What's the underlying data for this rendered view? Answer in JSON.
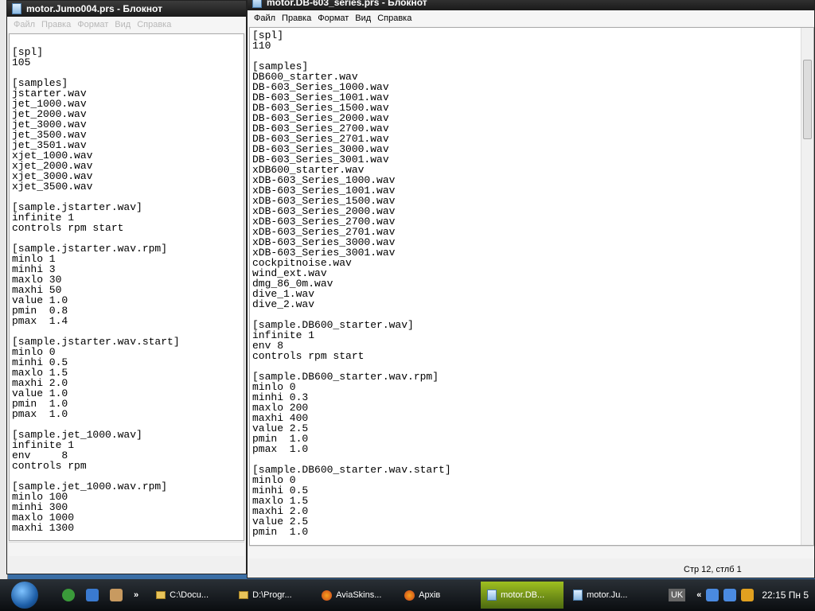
{
  "left_window": {
    "title": "motor.Jumo004.prs - Блокнот",
    "menu": [
      "Файл",
      "Правка",
      "Формат",
      "Вид",
      "Справка"
    ],
    "lines": [
      "",
      "[spl]",
      "105",
      "",
      "[samples]",
      "jstarter.wav",
      "jet_1000.wav",
      "jet_2000.wav",
      "jet_3000.wav",
      "jet_3500.wav",
      "jet_3501.wav",
      "xjet_1000.wav",
      "xjet_2000.wav",
      "xjet_3000.wav",
      "xjet_3500.wav",
      "",
      "[sample.jstarter.wav]",
      "infinite 1",
      "controls rpm start",
      "",
      "[sample.jstarter.wav.rpm]",
      "minlo 1",
      "minhi 3",
      "maxlo 30",
      "maxhi 50",
      "value 1.0",
      "pmin  0.8",
      "pmax  1.4",
      "",
      "[sample.jstarter.wav.start]",
      "minlo 0",
      "minhi 0.5",
      "maxlo 1.5",
      "maxhi 2.0",
      "value 1.0",
      "pmin  1.0",
      "pmax  1.0",
      "",
      "[sample.jet_1000.wav]",
      "infinite 1",
      "env     8",
      "controls rpm",
      "",
      "[sample.jet_1000.wav.rpm]",
      "minlo 100",
      "minhi 300",
      "maxlo 1000",
      "maxhi 1300"
    ]
  },
  "right_window": {
    "title": "motor.DB-603_series.prs - Блокнот",
    "menu": [
      "Файл",
      "Правка",
      "Формат",
      "Вид",
      "Справка"
    ],
    "lines": [
      "[spl]",
      "110",
      "",
      "[samples]",
      "DB600_starter.wav",
      "DB-603_Series_1000.wav",
      "DB-603_Series_1001.wav",
      "DB-603_Series_1500.wav",
      "DB-603_Series_2000.wav",
      "DB-603_Series_2700.wav",
      "DB-603_Series_2701.wav",
      "DB-603_Series_3000.wav",
      "DB-603_Series_3001.wav",
      "xDB600_starter.wav",
      "xDB-603_Series_1000.wav",
      "xDB-603_Series_1001.wav",
      "xDB-603_Series_1500.wav",
      "xDB-603_Series_2000.wav",
      "xDB-603_Series_2700.wav",
      "xDB-603_Series_2701.wav",
      "xDB-603_Series_3000.wav",
      "xDB-603_Series_3001.wav",
      "cockpitnoise.wav",
      "wind_ext.wav",
      "dmg_86_0m.wav",
      "dive_1.wav",
      "dive_2.wav",
      "",
      "[sample.DB600_starter.wav]",
      "infinite 1",
      "env 8",
      "controls rpm start",
      "",
      "[sample.DB600_starter.wav.rpm]",
      "minlo 0",
      "minhi 0.3",
      "maxlo 200",
      "maxhi 400",
      "value 2.5",
      "pmin  1.0",
      "pmax  1.0",
      "",
      "[sample.DB600_starter.wav.start]",
      "minlo 0",
      "minhi 0.5",
      "maxlo 1.5",
      "maxhi 2.0",
      "value 2.5",
      "pmin  1.0"
    ],
    "status": "Стр 12, стлб 1"
  },
  "taskbar": {
    "items": [
      "C:\\Docu...",
      "D:\\Progr...",
      "AviaSkins...",
      "Архів",
      "motor.DB...",
      "motor.Ju..."
    ],
    "lang": "UK",
    "chevron": "«",
    "quicklaunch_more": "»",
    "clock": "22:15 Пн 5"
  }
}
